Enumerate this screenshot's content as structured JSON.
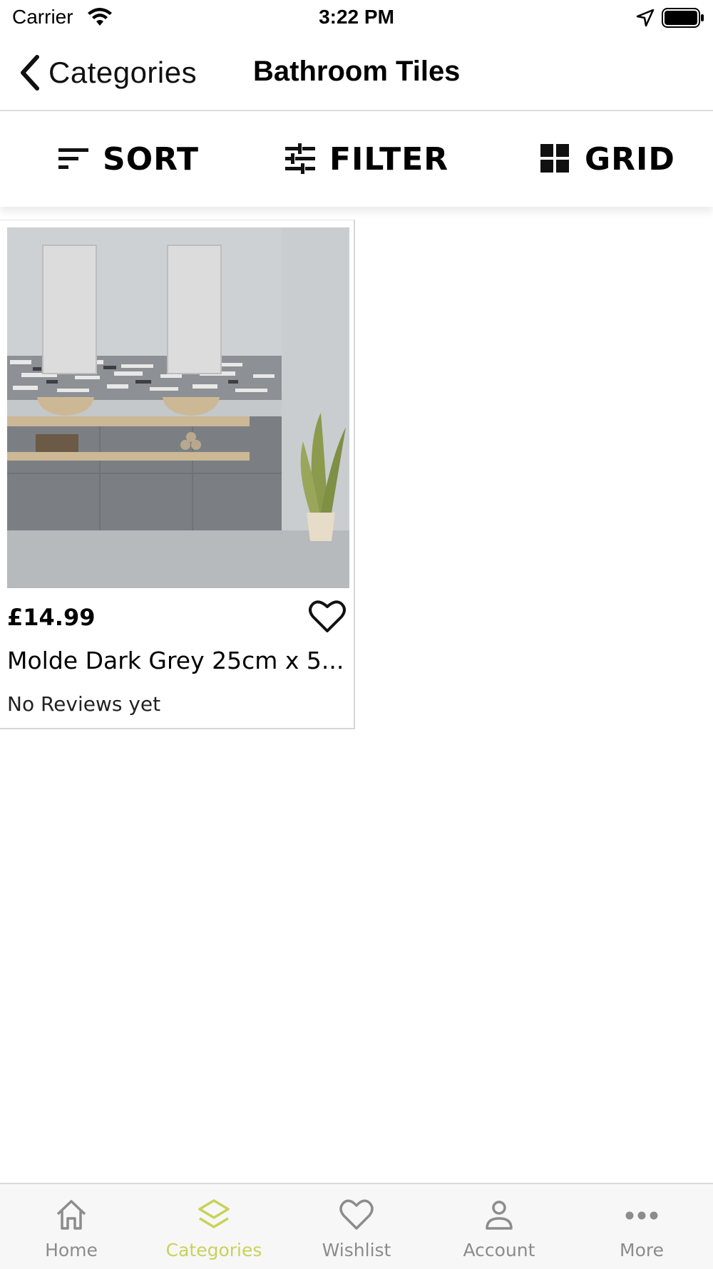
{
  "status_bar": {
    "carrier": "Carrier",
    "time": "3:22 PM"
  },
  "nav": {
    "back_label": "Categories",
    "title": "Bathroom Tiles"
  },
  "toolbar": {
    "sort_label": "SORT",
    "filter_label": "FILTER",
    "grid_label": "GRID"
  },
  "products": [
    {
      "price": "£14.99",
      "name": "Molde Dark Grey 25cm x 5...",
      "reviews": "No Reviews yet",
      "image": "bathroom-tiles-photo"
    }
  ],
  "tabbar": {
    "items": [
      {
        "label": "Home",
        "icon": "home-icon"
      },
      {
        "label": "Categories",
        "icon": "layers-icon",
        "active": true
      },
      {
        "label": "Wishlist",
        "icon": "heart-icon"
      },
      {
        "label": "Account",
        "icon": "user-icon"
      },
      {
        "label": "More",
        "icon": "more-icon"
      }
    ],
    "active_color": "#c8d25a",
    "inactive_color": "#8c8c8c"
  }
}
